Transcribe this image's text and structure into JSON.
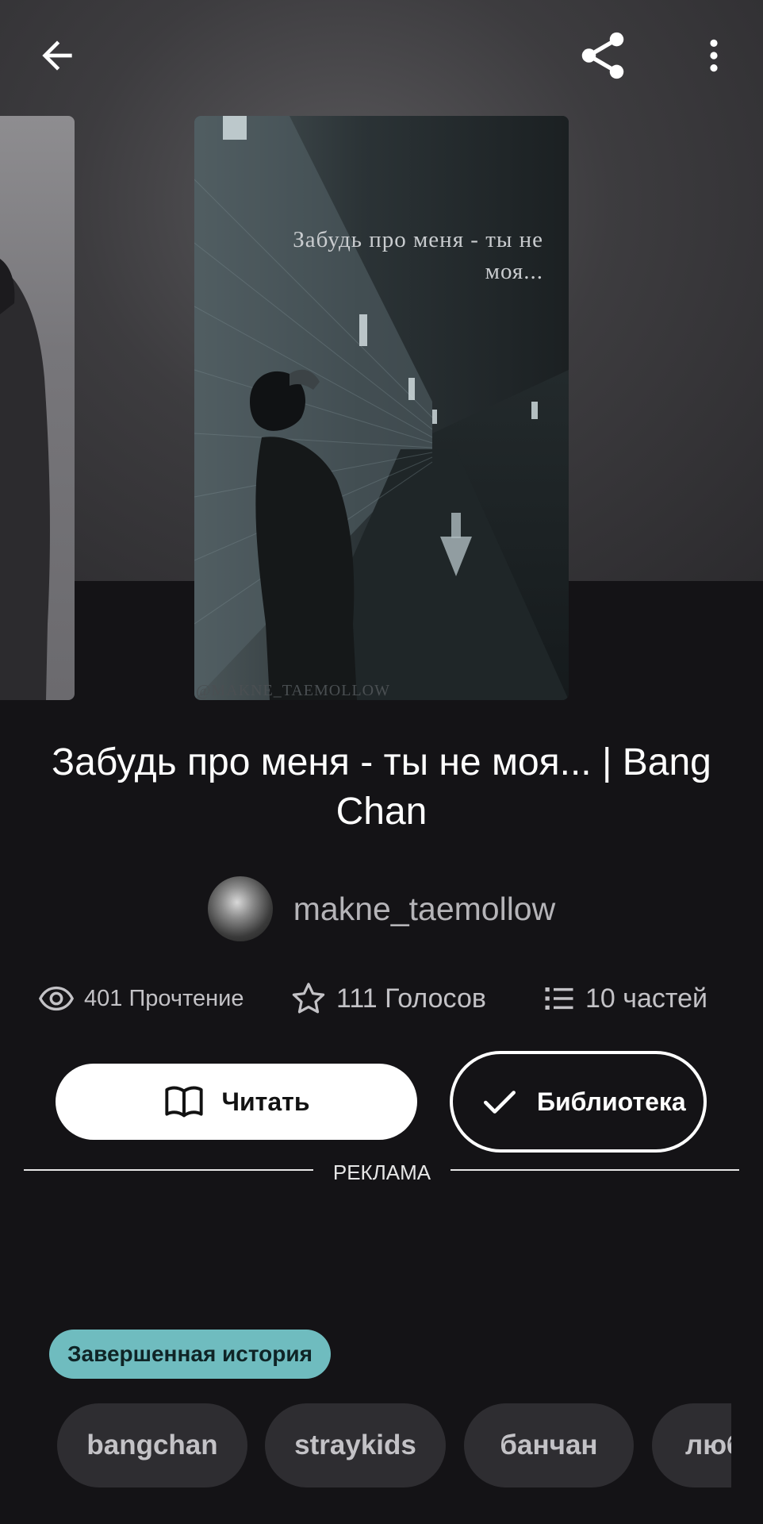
{
  "header": {
    "back_icon": "arrow-left-icon",
    "share_icon": "share-icon",
    "more_icon": "more-vertical-icon"
  },
  "cover": {
    "title_text": "Забудь про меня - ты не моя...",
    "watermark": "@MAKNE_TAEMOLLOW"
  },
  "story": {
    "title": "Забудь про меня - ты не моя... | Bang Chan"
  },
  "author": {
    "name": "makne_taemollow"
  },
  "stats": {
    "reads": "401 Прочтение",
    "votes": "111 Голосов",
    "parts": "10 частей"
  },
  "actions": {
    "read_label": "Читать",
    "library_label": "Библиотека"
  },
  "ad": {
    "label": "РЕКЛАМА"
  },
  "status_badge": "Завершенная история",
  "tags": [
    "bangchan",
    "straykids",
    "банчан",
    "любовь"
  ],
  "colors": {
    "background": "#141316",
    "badge": "#6fbcbf",
    "tag_bg": "#2e2d31"
  }
}
